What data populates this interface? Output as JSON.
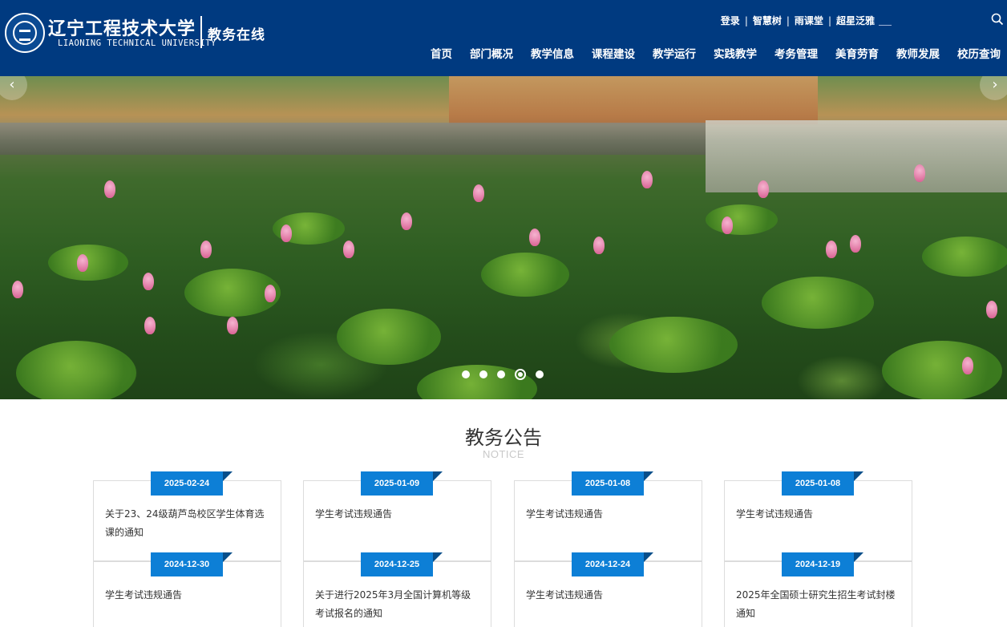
{
  "header": {
    "logo_cn": "辽宁工程技术大学",
    "logo_en": "LIAONING TECHNICAL UNIVERSITY",
    "logo_sub": "教务在线",
    "top_links": [
      "登录",
      "智慧树",
      "雨课堂",
      "超星泛雅"
    ],
    "separator": "|",
    "nav": [
      "首页",
      "部门概况",
      "教学信息",
      "课程建设",
      "教学运行",
      "实践教学",
      "考务管理",
      "美育劳育",
      "教师发展",
      "校历查询"
    ]
  },
  "banner": {
    "prev_label": "‹",
    "next_label": "›",
    "slide_count": 5,
    "active_slide": 4
  },
  "notices": {
    "title": "教务公告",
    "subtitle": "NOTICE",
    "items": [
      {
        "date": "2025-02-24",
        "title": "关于23、24级葫芦岛校区学生体育选课的通知"
      },
      {
        "date": "2025-01-09",
        "title": "学生考试违规通告"
      },
      {
        "date": "2025-01-08",
        "title": "学生考试违规通告"
      },
      {
        "date": "2025-01-08",
        "title": "学生考试违规通告"
      },
      {
        "date": "2024-12-30",
        "title": "学生考试违规通告"
      },
      {
        "date": "2024-12-25",
        "title": "关于进行2025年3月全国计算机等级考试报名的通知"
      },
      {
        "date": "2024-12-24",
        "title": "学生考试违规通告"
      },
      {
        "date": "2024-12-19",
        "title": "2025年全国硕士研究生招生考试封楼通知"
      }
    ]
  },
  "colors": {
    "header_bg": "#003a80",
    "date_badge": "#0d7fd6"
  }
}
